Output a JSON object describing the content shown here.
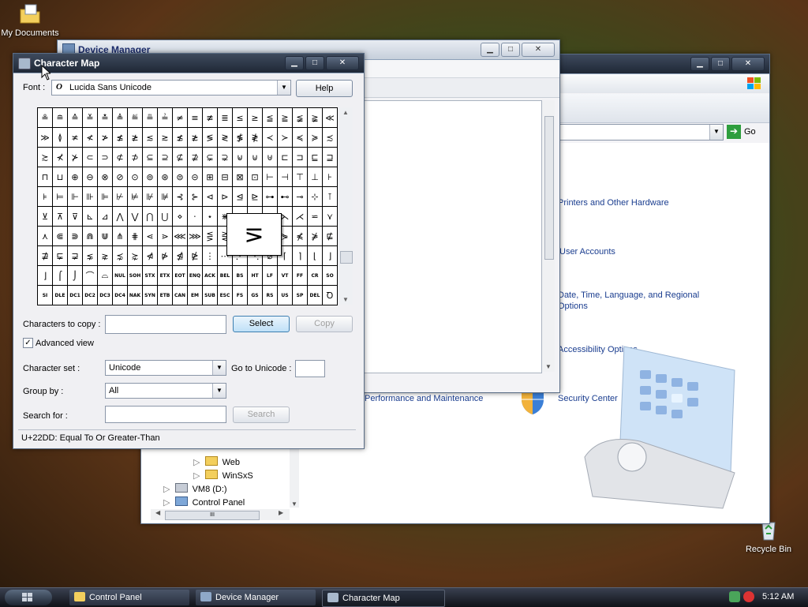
{
  "desktop": {
    "icons": [
      {
        "label": "My Documents"
      },
      {
        "label": "Recycle Bin"
      }
    ]
  },
  "control_panel": {
    "go_label": "Go",
    "links": [
      "Printers and Other Hardware",
      "User Accounts",
      "Date, Time, Language, and Regional",
      "Options",
      "Accessibility Options",
      "Performance and Maintenance",
      "Security Center"
    ],
    "tree": [
      "Web",
      "WinSxS",
      "VM8 (D:)",
      "Control Panel"
    ],
    "hscroll_thumb": "III"
  },
  "device_manager": {
    "title": "Device Manager"
  },
  "charmap": {
    "title": "Character Map",
    "font_label": "Font :",
    "font_value": "Lucida Sans Unicode",
    "font_icon_glyph": "O",
    "help_label": "Help",
    "grid": [
      [
        "≗",
        "≘",
        "≙",
        "≚",
        "≛",
        "≜",
        "≝",
        "≞",
        "≟",
        "≠",
        "≡",
        "≢",
        "≣",
        "≤",
        "≥",
        "≦",
        "≧",
        "≨",
        "≩",
        "≪"
      ],
      [
        "≫",
        "≬",
        "≭",
        "≮",
        "≯",
        "≰",
        "≱",
        "≲",
        "≳",
        "≴",
        "≵",
        "≶",
        "≷",
        "≸",
        "≹",
        "≺",
        "≻",
        "≼",
        "≽",
        "≾"
      ],
      [
        "≿",
        "⊀",
        "⊁",
        "⊂",
        "⊃",
        "⊄",
        "⊅",
        "⊆",
        "⊇",
        "⊈",
        "⊉",
        "⊊",
        "⊋",
        "⊌",
        "⊍",
        "⊎",
        "⊏",
        "⊐",
        "⊑",
        "⊒"
      ],
      [
        "⊓",
        "⊔",
        "⊕",
        "⊖",
        "⊗",
        "⊘",
        "⊙",
        "⊚",
        "⊛",
        "⊜",
        "⊝",
        "⊞",
        "⊟",
        "⊠",
        "⊡",
        "⊢",
        "⊣",
        "⊤",
        "⊥",
        "⊦"
      ],
      [
        "⊧",
        "⊨",
        "⊩",
        "⊪",
        "⊫",
        "⊬",
        "⊭",
        "⊮",
        "⊯",
        "⊰",
        "⊱",
        "⊲",
        "⊳",
        "⊴",
        "⊵",
        "⊶",
        "⊷",
        "⊸",
        "⊹",
        "⊺"
      ],
      [
        "⊻",
        "⊼",
        "⊽",
        "⊾",
        "⊿",
        "⋀",
        "⋁",
        "⋂",
        "⋃",
        "⋄",
        "⋅",
        "⋆",
        "⋇",
        "⋈",
        "⋉",
        "⋊",
        "⋋",
        "⋌",
        "⋍",
        "⋎"
      ],
      [
        "⋏",
        "⋐",
        "⋑",
        "⋒",
        "⋓",
        "⋔",
        "⋕",
        "⋖",
        "⋗",
        "⋘",
        "⋙",
        "⋚",
        "⋛",
        "⋜",
        "⋝",
        "⋞",
        "⋟",
        "⋠",
        "⋡",
        "⋢"
      ],
      [
        "⋣",
        "⋤",
        "⋥",
        "⋦",
        "⋧",
        "⋨",
        "⋩",
        "⋪",
        "⋫",
        "⋬",
        "⋭",
        "⋮",
        "⋯",
        "⋰",
        "⋱",
        "⌀",
        "⌈",
        "⌉",
        "⌊",
        "⌋"
      ],
      [
        "⌋",
        "⌠",
        "⌡",
        "⌒",
        "⌓",
        "NUL",
        "SOH",
        "STX",
        "ETX",
        "EOT",
        "ENQ",
        "ACK",
        "BEL",
        "BS",
        "HT",
        "LF",
        "VT",
        "FF",
        "CR",
        "SO"
      ],
      [
        "SI",
        "DLE",
        "DC1",
        "DC2",
        "DC3",
        "DC4",
        "NAK",
        "SYN",
        "ETB",
        "CAN",
        "EM",
        "SUB",
        "ESC",
        "FS",
        "GS",
        "RS",
        "US",
        "SP",
        "DEL",
        "Ꝺ"
      ]
    ],
    "zoom_glyph": "⋝",
    "chars_to_copy_label": "Characters to copy :",
    "chars_to_copy_value": "",
    "select_label": "Select",
    "copy_label": "Copy",
    "advanced_view_label": "Advanced view",
    "advanced_view_checked": true,
    "charset_label": "Character set :",
    "charset_value": "Unicode",
    "goto_unicode_label": "Go to Unicode :",
    "goto_unicode_value": "",
    "groupby_label": "Group by :",
    "groupby_value": "All",
    "search_label": "Search for :",
    "search_value": "",
    "search_button": "Search",
    "status": "U+22DD: Equal To Or Greater-Than"
  },
  "taskbar": {
    "items": [
      "Control Panel",
      "Device Manager",
      "Character Map"
    ],
    "clock": "5:12 AM"
  },
  "colors": {
    "link": "#1a3d8f",
    "taskbar": "#1a1f28"
  }
}
